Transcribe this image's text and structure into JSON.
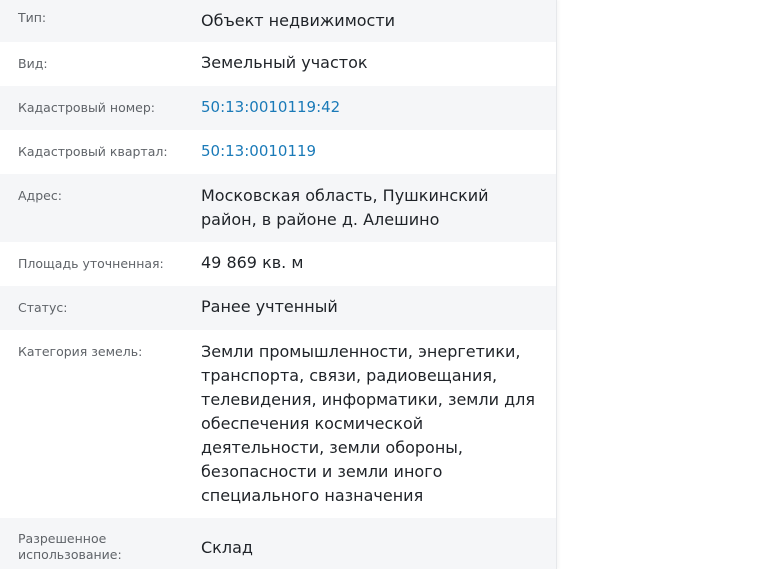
{
  "rows": {
    "type": {
      "label": "Тип:",
      "value": "Объект недвижимости"
    },
    "kind": {
      "label": "Вид:",
      "value": "Земельный участок"
    },
    "cadnum": {
      "label": "Кадастровый номер:",
      "value": "50:13:0010119:42"
    },
    "quarter": {
      "label": "Кадастровый квартал:",
      "value": "50:13:0010119"
    },
    "address": {
      "label": "Адрес:",
      "value": "Московская область, Пушкинский район, в районе д. Алешино"
    },
    "area": {
      "label": "Площадь уточненная:",
      "value": "49 869 кв. м"
    },
    "status": {
      "label": "Статус:",
      "value": "Ранее учтенный"
    },
    "category": {
      "label": "Категория земель:",
      "value": "Земли промышленности, энергетики, транспорта, связи, радиовещания, телевидения, информатики, земли для обеспечения космической деятельности, земли обороны, безопасности и земли иного специального назначения"
    },
    "usage": {
      "label": "Разрешенное использование:",
      "value": "Склад"
    }
  },
  "colors": {
    "label": "#5f6368",
    "value": "#1f2328",
    "link": "#1a7ab8",
    "row_alt_background": "#f5f6f8"
  }
}
